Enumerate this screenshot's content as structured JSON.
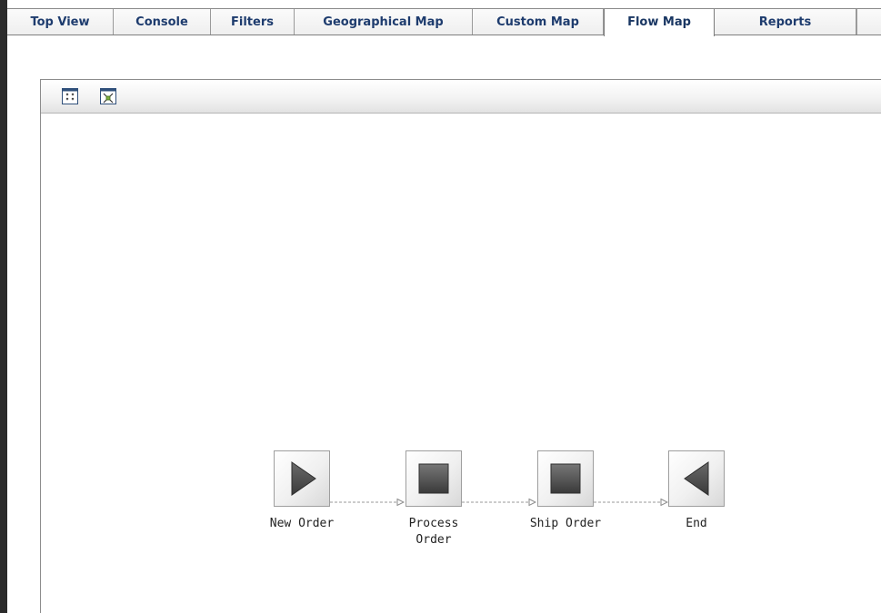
{
  "tabs": [
    {
      "label": "Top View",
      "active": false
    },
    {
      "label": "Console",
      "active": false
    },
    {
      "label": "Filters",
      "active": false
    },
    {
      "label": "Geographical Map",
      "active": false
    },
    {
      "label": "Custom Map",
      "active": false
    },
    {
      "label": "Flow Map",
      "active": true
    },
    {
      "label": "Reports",
      "active": false
    }
  ],
  "toolbar": {
    "buttons": [
      {
        "icon": "collapse-all-icon"
      },
      {
        "icon": "fit-to-window-icon"
      }
    ]
  },
  "flow": {
    "nodes": [
      {
        "label": "New Order",
        "icon": "play-triangle-icon"
      },
      {
        "label": "Process\nOrder",
        "icon": "stop-square-icon"
      },
      {
        "label": "Ship Order",
        "icon": "stop-square-icon"
      },
      {
        "label": "End",
        "icon": "reverse-triangle-icon"
      }
    ]
  },
  "colors": {
    "tab_text": "#1e3c6e",
    "node_shape": "#555555",
    "connector": "#9a9a9a"
  }
}
